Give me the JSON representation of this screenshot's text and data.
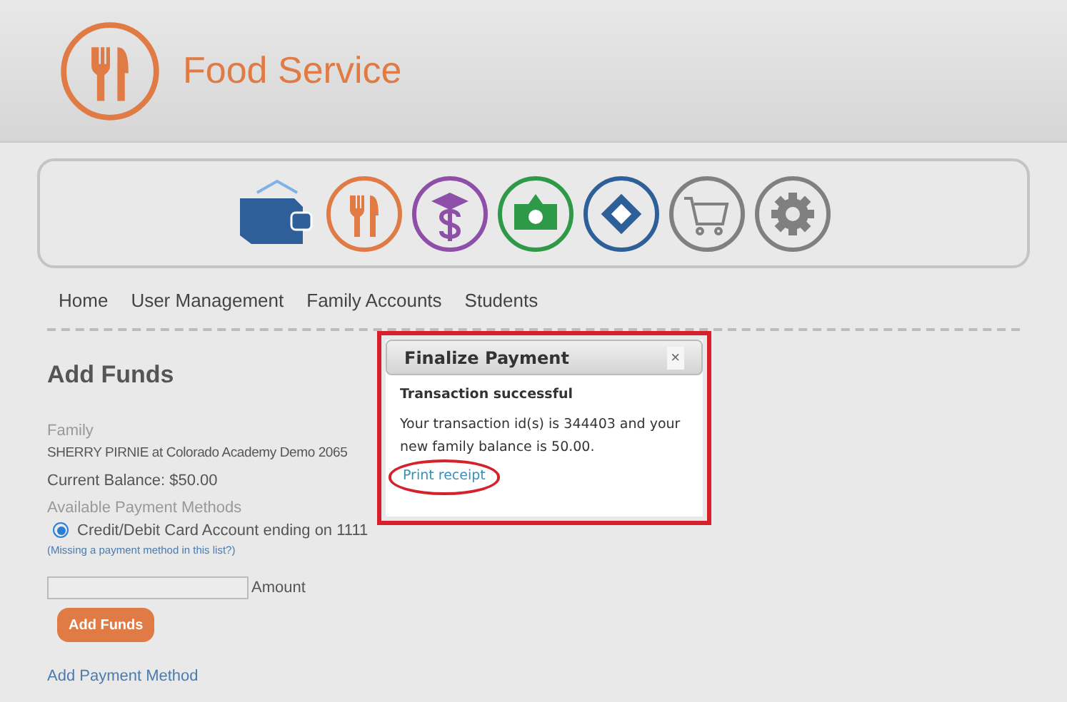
{
  "header": {
    "title": "Food Service"
  },
  "app_icons": [
    {
      "kind": "wallet",
      "color": "#2f5f98"
    },
    {
      "kind": "food",
      "color": "#e07b45"
    },
    {
      "kind": "tuition",
      "color": "#8e4fa8"
    },
    {
      "kind": "money",
      "color": "#2e9a48"
    },
    {
      "kind": "ticket",
      "color": "#2f5f98"
    },
    {
      "kind": "cart",
      "color": "#808080"
    },
    {
      "kind": "settings",
      "color": "#808080"
    }
  ],
  "nav": [
    "Home",
    "User Management",
    "Family Accounts",
    "Students"
  ],
  "add_funds": {
    "title": "Add Funds",
    "family_label": "Family",
    "family": "SHERRY PIRNIE at Colorado Academy Demo 2065",
    "balance": "Current Balance: $50.00",
    "methods_label": "Available Payment Methods",
    "methods": [
      {
        "label": "Credit/Debit Card Account ending on 1111",
        "selected": true
      }
    ],
    "missing": "(Missing a payment method in this list?)",
    "amount_label": "Amount",
    "button": "Add Funds",
    "add_method": "Add Payment Method"
  },
  "dialog": {
    "title": "Finalize Payment",
    "close": "×",
    "heading": "Transaction successful",
    "message": "Your transaction id(s) is 344403 and your new family balance is 50.00.",
    "link": "Print receipt"
  }
}
